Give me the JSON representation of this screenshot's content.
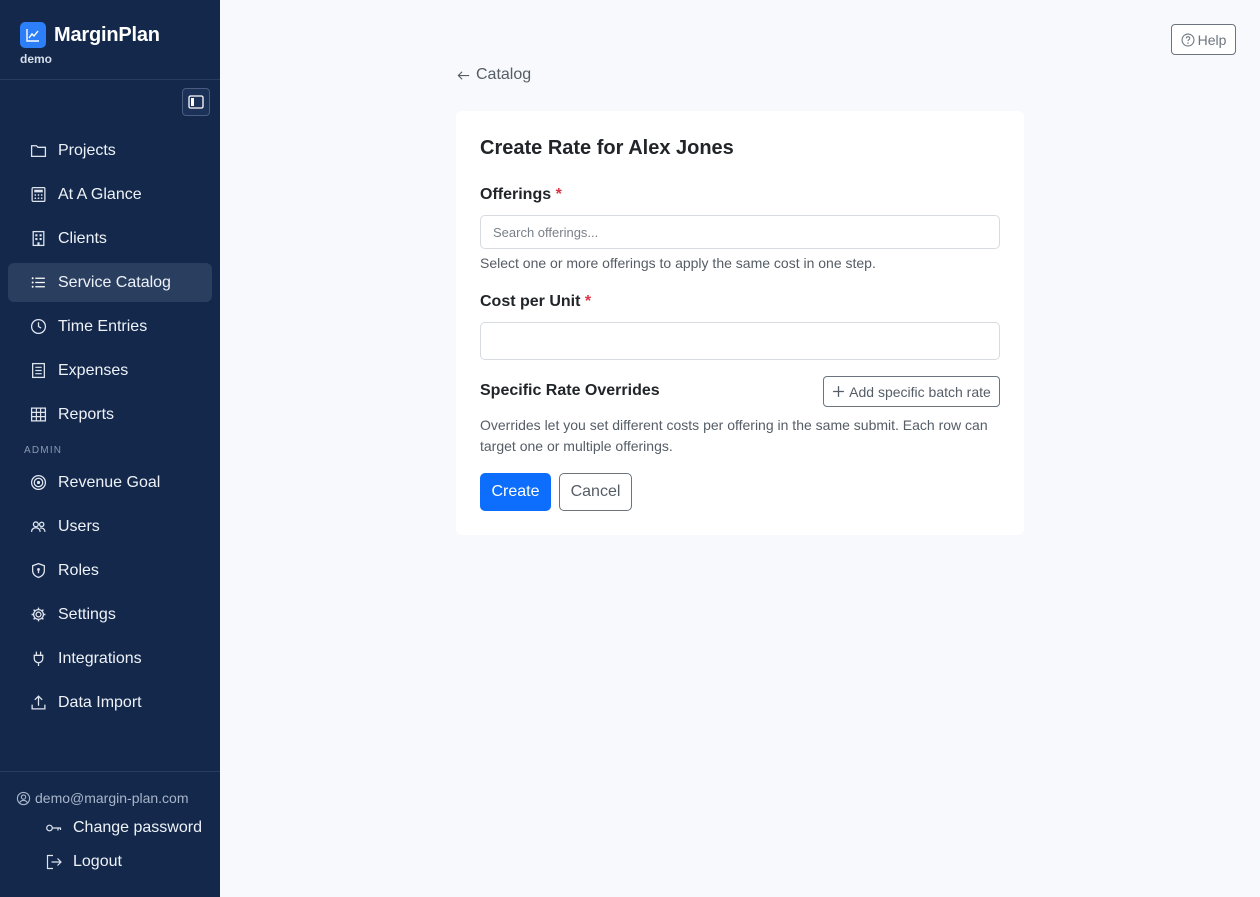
{
  "brand": {
    "name": "MarginPlan",
    "workspace": "demo",
    "logo_icon": "chart-line-icon",
    "accent": "#2d7ff9"
  },
  "sidebar": {
    "background": "#13284a",
    "items": [
      {
        "label": "Projects",
        "icon": "folder-icon",
        "active": false
      },
      {
        "label": "At A Glance",
        "icon": "calculator-icon",
        "active": false
      },
      {
        "label": "Clients",
        "icon": "building-icon",
        "active": false
      },
      {
        "label": "Service Catalog",
        "icon": "list-icon",
        "active": true
      },
      {
        "label": "Time Entries",
        "icon": "clock-icon",
        "active": false
      },
      {
        "label": "Expenses",
        "icon": "receipt-icon",
        "active": false
      },
      {
        "label": "Reports",
        "icon": "table-icon",
        "active": false
      }
    ],
    "admin_label": "ADMIN",
    "admin_items": [
      {
        "label": "Revenue Goal",
        "icon": "target-icon"
      },
      {
        "label": "Users",
        "icon": "people-icon"
      },
      {
        "label": "Roles",
        "icon": "shield-icon"
      },
      {
        "label": "Settings",
        "icon": "gear-icon"
      },
      {
        "label": "Integrations",
        "icon": "plug-icon"
      },
      {
        "label": "Data Import",
        "icon": "upload-icon"
      }
    ],
    "user_email": "demo@margin-plan.com",
    "change_password": "Change password",
    "logout": "Logout"
  },
  "header": {
    "help_label": "Help"
  },
  "breadcrumb": {
    "back_label": "Catalog"
  },
  "form": {
    "title": "Create Rate for Alex Jones",
    "offerings_label": "Offerings",
    "offerings_placeholder": "Search offerings...",
    "offerings_value": "",
    "offerings_help": "Select one or more offerings to apply the same cost in one step.",
    "cost_label": "Cost per Unit",
    "cost_value": "",
    "required_mark": "*",
    "overrides_label": "Specific Rate Overrides",
    "add_batch_label": "Add specific batch rate",
    "overrides_help": "Overrides let you set different costs per offering in the same submit. Each row can target one or multiple offerings.",
    "create_label": "Create",
    "cancel_label": "Cancel",
    "primary_color": "#0d6efd"
  }
}
